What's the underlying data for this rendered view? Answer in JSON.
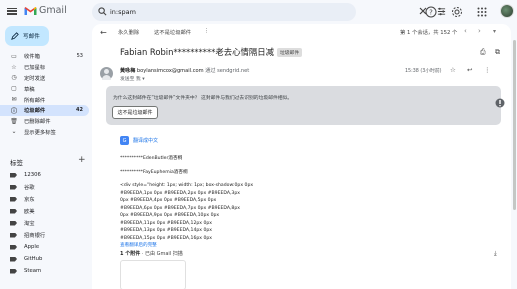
{
  "app": {
    "name": "Gmail",
    "brand_colors": {
      "red": "#ea4335",
      "blue": "#4285f4",
      "green": "#34a853",
      "yellow": "#fbbc04"
    }
  },
  "search": {
    "value": "in:spam",
    "placeholder": "搜索邮件"
  },
  "compose": {
    "label": "写邮件"
  },
  "nav": [
    {
      "label": "收件箱",
      "count": "53",
      "icon": "inbox-icon",
      "active": false
    },
    {
      "label": "已加星标",
      "count": "",
      "icon": "star-icon",
      "active": false
    },
    {
      "label": "定时发送",
      "count": "",
      "icon": "clock-icon",
      "active": false
    },
    {
      "label": "草稿",
      "count": "",
      "icon": "draft-icon",
      "active": false
    },
    {
      "label": "所有邮件",
      "count": "",
      "icon": "mail-icon",
      "active": false
    },
    {
      "label": "垃圾邮件",
      "count": "42",
      "icon": "spam-icon",
      "active": true
    },
    {
      "label": "已删除邮件",
      "count": "",
      "icon": "trash-icon",
      "active": false
    },
    {
      "label": "显示更多标签",
      "count": "",
      "icon": "chevron-down-icon",
      "active": false
    }
  ],
  "labels": {
    "heading": "标签",
    "items": [
      "12306",
      "谷歌",
      "京东",
      "欧美",
      "淘宝",
      "招商银行",
      "Apple",
      "GitHub",
      "Steam"
    ]
  },
  "toolbar": {
    "delete_forever": "永久删除",
    "not_spam": "这不是垃圾邮件",
    "pager": "第 1 个会话，共 152 个"
  },
  "message": {
    "subject": "Fabian Robin**********老去心情隔日减",
    "badge": "垃圾邮件",
    "sender_name": "黄咏梅",
    "sender_email": "boylansimcox@gmail.com",
    "via_text": "通过",
    "via_domain": "sendgrid.net",
    "to": "发送至 我",
    "time": "15:38 (3小时前)"
  },
  "spam_notice": {
    "text": "为什么这封邮件在“垃圾邮件”文件夹中？ 这封邮件与我们过去识别的垃圾邮件相似。",
    "button": "这不是垃圾邮件"
  },
  "translate": {
    "label": "翻译成中文"
  },
  "body": {
    "line1": "**********EdenButler酒杏桐",
    "line2": "**********FayEuphemia酒杏桐",
    "code_lines": [
      "<div style=\"height: 1px; width: 1px; box-shadow:0px 0px",
      "#B9EEDA,1px 0px #B9EEDA,2px 0px #B9EEDA,3px",
      "0px #B9EEDA,4px 0px #B9EEDA,5px 0px",
      "#B9EEDA,6px 0px #B9EEDA,7px 0px #B9EEDA,8px",
      "0px #B9EEDA,9px 0px #B9EEDA,10px 0px",
      "#B9EEDA,11px 0px #B9EEDA,12px 0px",
      "#B9EEDA,13px 0px #B9EEDA,14px 0px",
      "#B9EEDA,15px 0px #B9EEDA,16px 0px"
    ],
    "link_text": "查看翻译后的完整"
  },
  "attachments": {
    "count_label": "1 个附件",
    "scan_label": "· 已由 Gmail 扫描"
  }
}
